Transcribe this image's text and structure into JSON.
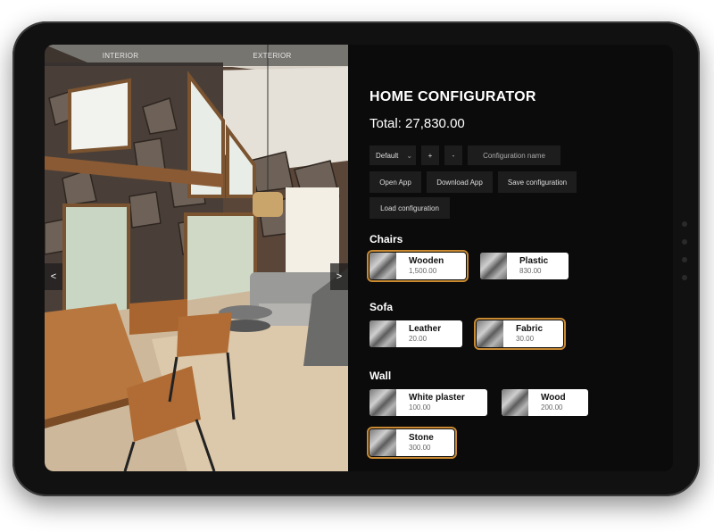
{
  "view": {
    "tabs": [
      "INTERIOR",
      "EXTERIOR"
    ],
    "prev_label": "<",
    "next_label": ">"
  },
  "configurator": {
    "title": "HOME CONFIGURATOR",
    "total": "Total: 27,830.00",
    "preset_value": "Default",
    "preset_chevron": "⌄",
    "add_label": "+",
    "remove_label": "-",
    "config_name_placeholder": "Configuration name",
    "open_app_label": "Open App",
    "download_app_label": "Download App",
    "save_config_label": "Save configuration",
    "load_config_label": "Load configuration"
  },
  "sections": {
    "chairs": {
      "title": "Chairs",
      "options": [
        {
          "name": "Wooden",
          "price": "1,500.00",
          "selected": true
        },
        {
          "name": "Plastic",
          "price": "830.00",
          "selected": false
        }
      ]
    },
    "sofa": {
      "title": "Sofa",
      "options": [
        {
          "name": "Leather",
          "price": "20.00",
          "selected": false
        },
        {
          "name": "Fabric",
          "price": "30.00",
          "selected": true
        }
      ]
    },
    "wall": {
      "title": "Wall",
      "options": [
        {
          "name": "White plaster",
          "price": "100.00",
          "selected": false
        },
        {
          "name": "Wood",
          "price": "200.00",
          "selected": false
        },
        {
          "name": "Stone",
          "price": "300.00",
          "selected": true
        }
      ]
    }
  },
  "colors": {
    "accent": "#c98a32",
    "panel_bg": "#0b0b0b",
    "control_bg": "#1d1d1d"
  }
}
